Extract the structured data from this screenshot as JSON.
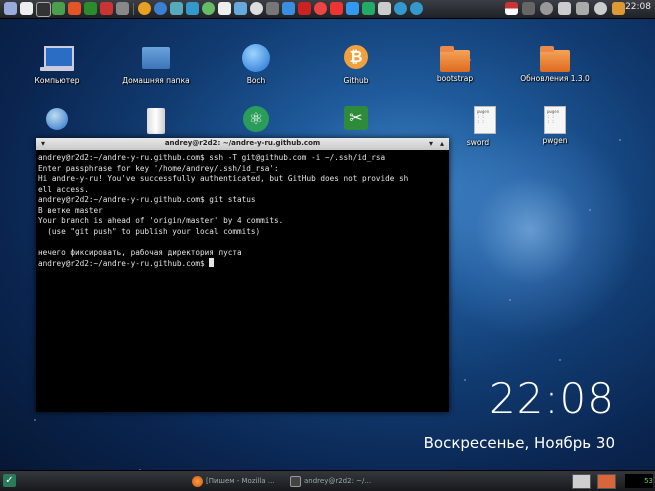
{
  "top_panel": {
    "clock": "22:08",
    "launchers": [
      "monitor-icon",
      "folder-icon",
      "terminal-icon",
      "firefox-icon",
      "skype-icon",
      "settings-icon",
      "calendar-icon",
      "browser-icon",
      "chat-icon",
      "chromium-icon",
      "photo-icon",
      "drive-icon",
      "mail-icon",
      "dropbox-icon",
      "filezilla-icon",
      "git-icon",
      "tools-icon",
      "games-icon",
      "apps-icon",
      "help-icon"
    ]
  },
  "desktop_icons": [
    {
      "label": "Компьютер",
      "icon": "laptop-icon"
    },
    {
      "label": "Домашняя папка",
      "icon": "home-folder-icon"
    },
    {
      "label": "Boch",
      "icon": "globe-icon"
    },
    {
      "label": "Github",
      "icon": "bitcoin-icon"
    },
    {
      "label": "bootstrap",
      "icon": "folder-icon"
    },
    {
      "label": "Обновления 1.3.0",
      "icon": "folder-icon"
    },
    {
      "label": "sword",
      "icon": "tools-icon"
    },
    {
      "label": "pwgen",
      "icon": "document-icon"
    }
  ],
  "terminal": {
    "title": "andrey@r2d2: ~/andre-y-ru.github.com",
    "lines": [
      "andrey@r2d2:~/andre-y-ru.github.com$ ssh -T git@github.com -i ~/.ssh/id_rsa",
      "Enter passphrase for key '/home/andrey/.ssh/id_rsa':",
      "Hi andre-y-ru! You've successfully authenticated, but GitHub does not provide sh",
      "ell access.",
      "andrey@r2d2:~/andre-y-ru.github.com$ git status",
      "В ветке master",
      "Your branch is ahead of 'origin/master' by 4 commits.",
      "  (use \"git push\" to publish your local commits)",
      "",
      "нечего фиксировать, рабочая директория пуста"
    ],
    "prompt": "andrey@r2d2:~/andre-y-ru.github.com$ "
  },
  "desktop_clock": {
    "time": "22:08",
    "date": "Воскресенье, Ноябрь 30"
  },
  "taskbar": {
    "tasks": [
      {
        "label": "[Пишем - Mozilla ...",
        "icon": "firefox-icon"
      },
      {
        "label": "andrey@r2d2: ~/...",
        "icon": "terminal-icon"
      }
    ],
    "cpu_value": "53"
  }
}
